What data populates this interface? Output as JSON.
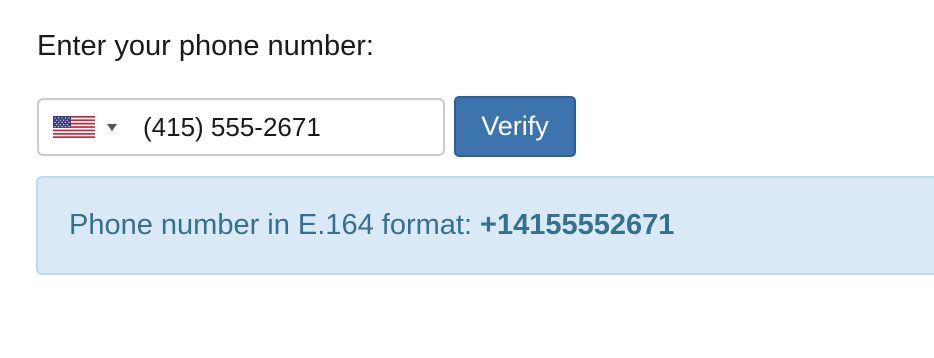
{
  "form": {
    "label": "Enter your phone number:",
    "country": {
      "code": "US",
      "flag_icon": "us-flag-icon"
    },
    "phone_value": "(415) 555-2671",
    "verify_label": "Verify"
  },
  "result": {
    "label": "Phone number in E.164 format:",
    "value": "+14155552671"
  },
  "colors": {
    "button_bg": "#3d74ad",
    "info_bg": "#d9eaf6",
    "info_text": "#35708e"
  }
}
